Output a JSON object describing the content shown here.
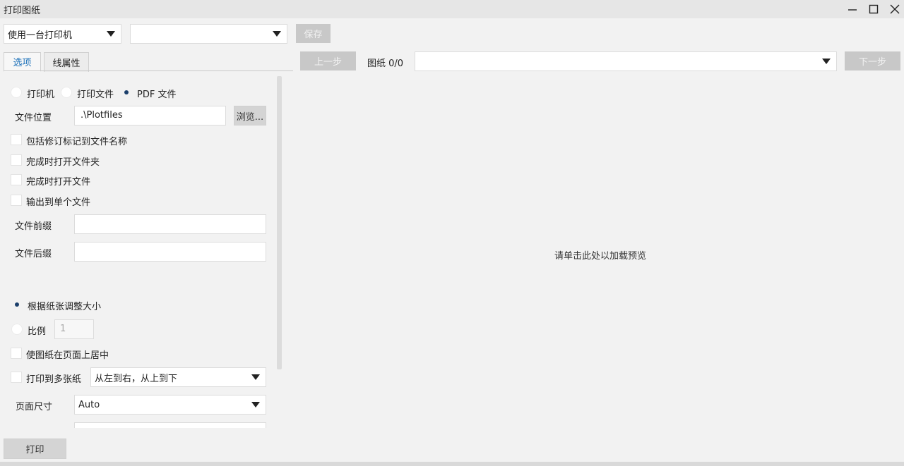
{
  "window": {
    "title": "打印图纸"
  },
  "toolbar": {
    "printer_select": "使用一台打印机",
    "profile_select": "",
    "save_label": "保存"
  },
  "tabs": [
    {
      "label": "选项"
    },
    {
      "label": "线属性"
    }
  ],
  "output": {
    "printer_label": "打印机",
    "print_file_label": "打印文件",
    "pdf_label": "PDF 文件",
    "selected": "PDF 文件"
  },
  "file": {
    "location_label": "文件位置",
    "location_value": ".\\Plotfiles",
    "browse_label": "浏览...",
    "prefix_label": "文件前缀",
    "prefix_value": "",
    "suffix_label": "文件后缀",
    "suffix_value": ""
  },
  "options": {
    "include_rev": "包括修订标记到文件名称",
    "open_folder": "完成时打开文件夹",
    "open_file": "完成时打开文件",
    "single_file": "输出到单个文件"
  },
  "scaling": {
    "fit_label": "根据纸张调整大小",
    "scale_label": "比例",
    "scale_value": "1",
    "center_label": "使图纸在页面上居中",
    "multi_label": "打印到多张纸",
    "order_select": "从左到右，从上到下",
    "page_size_label": "页面尺寸",
    "page_size_value": "Auto"
  },
  "footer": {
    "print_label": "打印"
  },
  "preview": {
    "prev_label": "上一步",
    "sheet_label": "图纸 0/0",
    "sheet_select": "",
    "next_label": "下一步",
    "message": "请单击此处以加载预览"
  }
}
